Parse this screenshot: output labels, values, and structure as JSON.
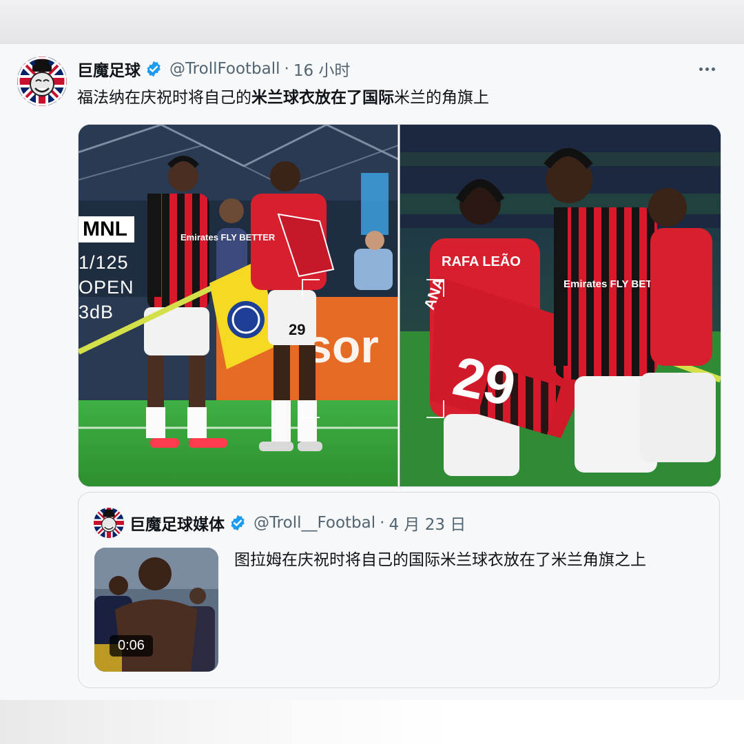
{
  "tweet": {
    "display_name": "巨魔足球",
    "handle": "@TrollFootball",
    "separator": "·",
    "time": "16 小时",
    "text_part1": "福法纳在庆祝时将自己的",
    "text_bold1": "米兰球衣放在了国际",
    "text_part2": "米兰的角旗上",
    "avatar_icon": "troll-union-jack-avatar",
    "verified_icon": "verified-badge-icon",
    "more_icon": "more-options-icon",
    "verified_color": "#1d9bf0"
  },
  "media": {
    "overlay": {
      "box_text": "MNL",
      "line1": "1/125",
      "line2": "OPEN",
      "line3": "3dB"
    },
    "left_photo": {
      "sponsor_text": "Emirates FLY BETTER",
      "shorts_number": "29",
      "board_text": "sor"
    },
    "right_photo": {
      "back_name": "RAFA LEÃO",
      "flag_number": "29",
      "flag_name": "ANA",
      "sponsor_text": "Emirates FLY BETTER"
    }
  },
  "quote": {
    "display_name": "巨魔足球媒体",
    "handle": "@Troll__Footbal",
    "separator": "·",
    "date": "4 月 23 日",
    "text": "图拉姆在庆祝时将自己的国际米兰球衣放在了米兰角旗之上",
    "video_duration": "0:06"
  }
}
